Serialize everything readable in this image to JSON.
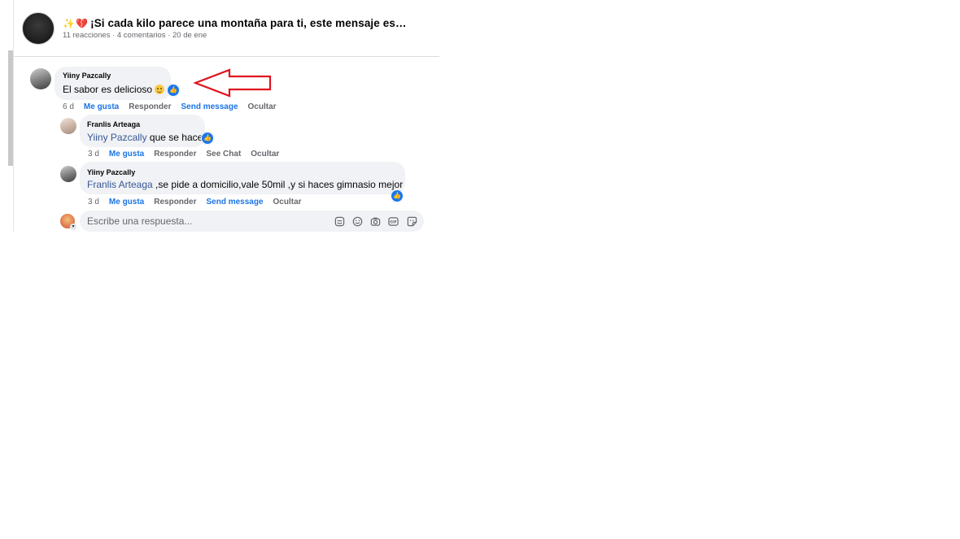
{
  "post": {
    "title_prefix_sparkle": "✨",
    "title_prefix_heart": "💔",
    "title": "¡Si cada kilo parece una montaña para ti, este mensaje es…",
    "meta": "11 reacciones · 4 comentarios · 20 de ene"
  },
  "comments": [
    {
      "author": "Yiiny Pazcally",
      "text": "El sabor es delicioso",
      "time": "6 d",
      "actions": [
        "Me gusta",
        "Responder",
        "Send message",
        "Ocultar"
      ]
    }
  ],
  "replies": [
    {
      "author": "Franlis Arteaga",
      "mention": "Yiiny Pazcally",
      "text": " que se hace",
      "time": "3 d",
      "actions": [
        "Me gusta",
        "Responder",
        "See Chat",
        "Ocultar"
      ]
    },
    {
      "author": "Yiiny Pazcally",
      "mention": "Franlis Arteaga",
      "text": " ,se pide a domicilio,vale 50mil ,y si haces gimnasio mejor",
      "time": "3 d",
      "actions": [
        "Me gusta",
        "Responder",
        "Send message",
        "Ocultar"
      ]
    }
  ],
  "reply_box": {
    "placeholder": "Escribe una respuesta..."
  },
  "colors": {
    "link_blue": "#1b74e4",
    "mention_blue": "#385898",
    "annotation_arrow": "#e0141e",
    "like_badge": "#1877f2"
  },
  "icons": [
    "like-icon",
    "sticker-icon",
    "emoji-icon",
    "camera-icon",
    "gif-icon",
    "avatar-sticker-icon",
    "annotation-arrow-icon"
  ]
}
